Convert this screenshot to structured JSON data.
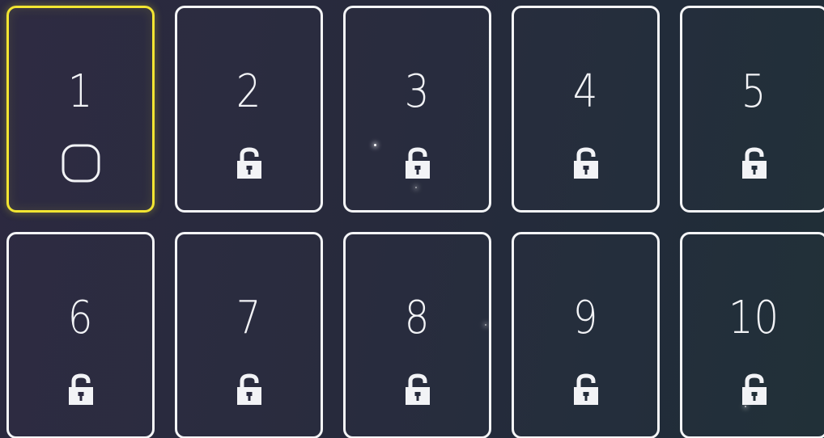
{
  "levels": [
    {
      "number": "1",
      "status": "unlocked",
      "selected": true,
      "icon": "square-outline-icon"
    },
    {
      "number": "2",
      "status": "locked",
      "selected": false,
      "icon": "lock-icon"
    },
    {
      "number": "3",
      "status": "locked",
      "selected": false,
      "icon": "lock-icon"
    },
    {
      "number": "4",
      "status": "locked",
      "selected": false,
      "icon": "lock-icon"
    },
    {
      "number": "5",
      "status": "locked",
      "selected": false,
      "icon": "lock-icon"
    },
    {
      "number": "6",
      "status": "locked",
      "selected": false,
      "icon": "lock-icon"
    },
    {
      "number": "7",
      "status": "locked",
      "selected": false,
      "icon": "lock-icon"
    },
    {
      "number": "8",
      "status": "locked",
      "selected": false,
      "icon": "lock-icon"
    },
    {
      "number": "9",
      "status": "locked",
      "selected": false,
      "icon": "lock-icon"
    },
    {
      "number": "10",
      "status": "locked",
      "selected": false,
      "icon": "lock-icon"
    }
  ],
  "colors": {
    "selected_border": "#f2e532",
    "card_border": "#f4f5f7",
    "text": "#f2f3f6"
  }
}
